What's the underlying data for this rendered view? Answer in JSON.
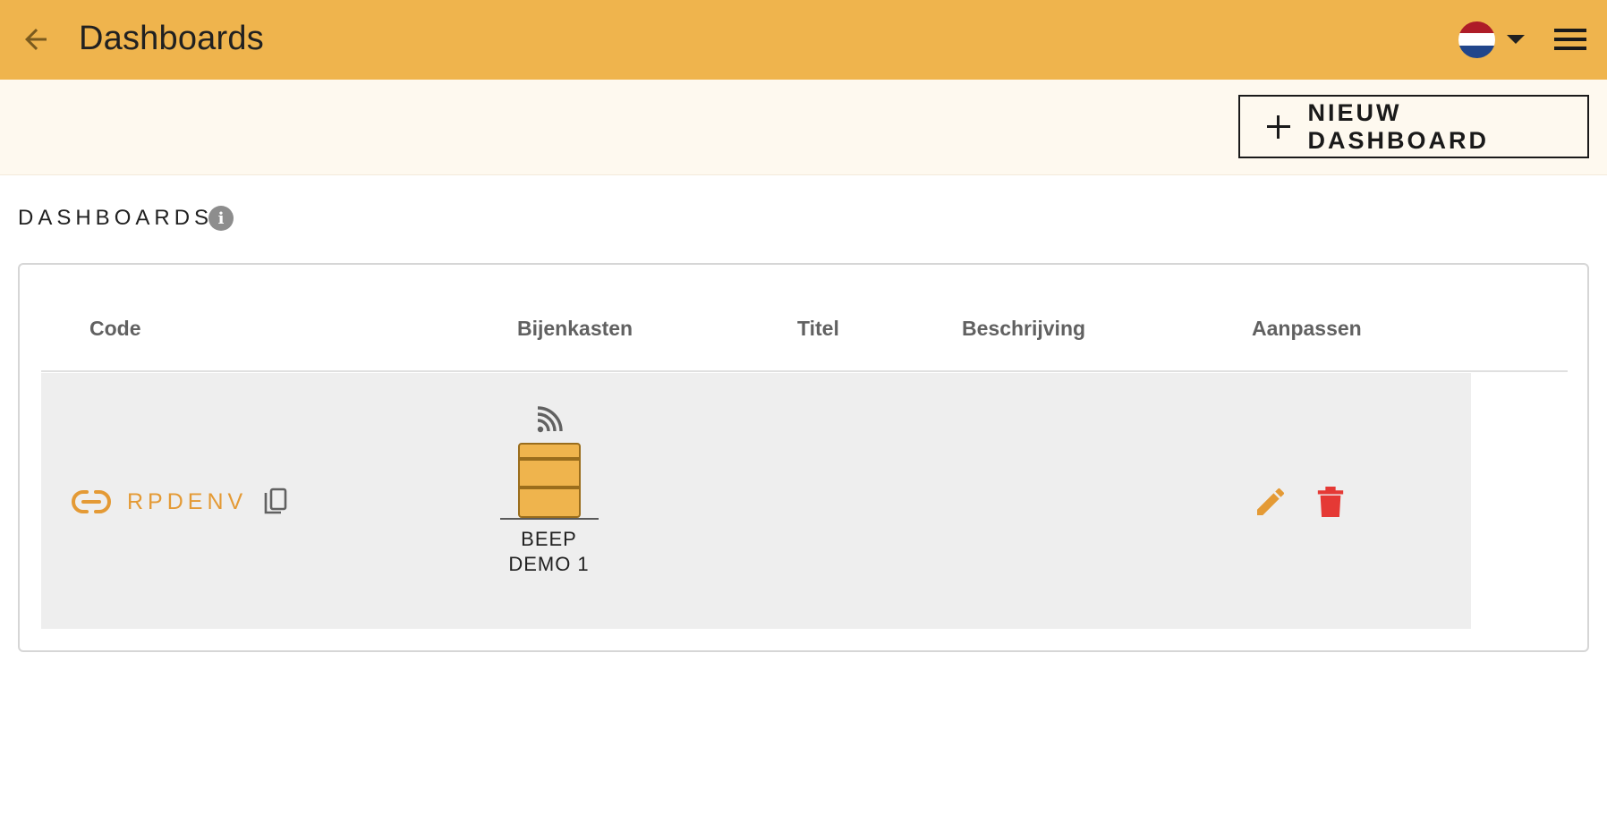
{
  "appbar": {
    "title": "Dashboards",
    "colors": {
      "background": "#efb44d"
    }
  },
  "language": {
    "selected_flag": "netherlands-flag-icon"
  },
  "toolbar": {
    "new_dashboard_label": "NIEUW DASHBOARD"
  },
  "section": {
    "title": "DASHBOARDS",
    "info_symbol": "i"
  },
  "table": {
    "columns": [
      "Code",
      "Bijenkasten",
      "Titel",
      "Beschrijving",
      "Aanpassen"
    ],
    "rows": [
      {
        "code": "RPDENV",
        "hive_name_line1": "BEEP",
        "hive_name_line2": "DEMO 1",
        "title": "",
        "description": ""
      }
    ]
  },
  "colors": {
    "accent": "#e49a35",
    "delete": "#e53935",
    "row_bg": "#eeeeee"
  }
}
